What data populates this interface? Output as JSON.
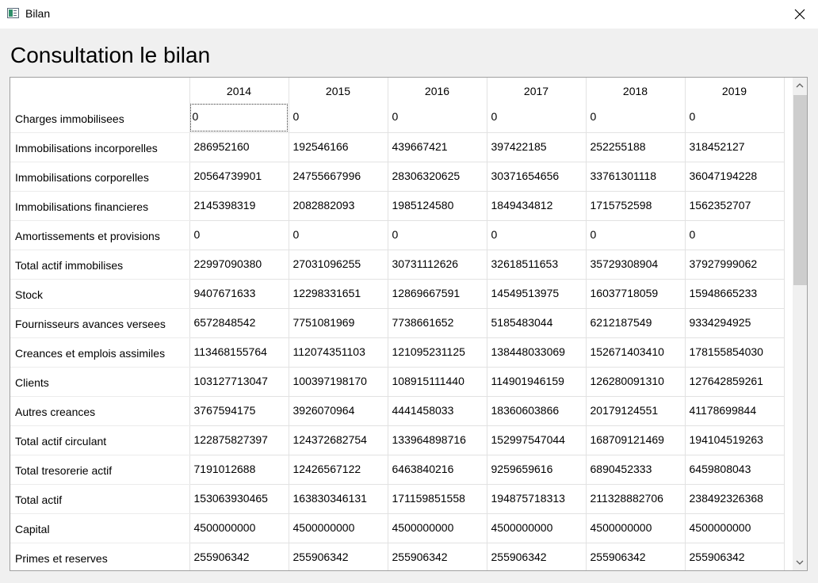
{
  "window": {
    "title": "Bilan",
    "icon": "app-window-icon",
    "close_icon": "close-icon"
  },
  "page": {
    "title": "Consultation le bilan"
  },
  "table": {
    "columns": [
      "2014",
      "2015",
      "2016",
      "2017",
      "2018",
      "2019"
    ],
    "rows": [
      {
        "label": "Charges immobilisees",
        "values": [
          "0",
          "0",
          "0",
          "0",
          "0",
          "0"
        ]
      },
      {
        "label": "Immobilisations incorporelles",
        "values": [
          "286952160",
          "192546166",
          "439667421",
          "397422185",
          "252255188",
          "318452127"
        ]
      },
      {
        "label": "Immobilisations corporelles",
        "values": [
          "20564739901",
          "24755667996",
          "28306320625",
          "30371654656",
          "33761301118",
          "36047194228"
        ]
      },
      {
        "label": "Immobilisations financieres",
        "values": [
          "2145398319",
          "2082882093",
          "1985124580",
          "1849434812",
          "1715752598",
          "1562352707"
        ]
      },
      {
        "label": "Amortissements et provisions",
        "values": [
          "0",
          "0",
          "0",
          "0",
          "0",
          "0"
        ]
      },
      {
        "label": "Total actif immobilises",
        "values": [
          "22997090380",
          "27031096255",
          "30731112626",
          "32618511653",
          "35729308904",
          "37927999062"
        ]
      },
      {
        "label": "Stock",
        "values": [
          "9407671633",
          "12298331651",
          "12869667591",
          "14549513975",
          "16037718059",
          "15948665233"
        ]
      },
      {
        "label": "Fournisseurs avances versees",
        "values": [
          "6572848542",
          "7751081969",
          "7738661652",
          "5185483044",
          "6212187549",
          "9334294925"
        ]
      },
      {
        "label": "Creances et emplois assimiles",
        "values": [
          "113468155764",
          "112074351103",
          "121095231125",
          "138448033069",
          "152671403410",
          "178155854030"
        ]
      },
      {
        "label": "Clients",
        "values": [
          "103127713047",
          "100397198170",
          "108915111440",
          "114901946159",
          "126280091310",
          "127642859261"
        ]
      },
      {
        "label": "Autres creances",
        "values": [
          "3767594175",
          "3926070964",
          "4441458033",
          "18360603866",
          "20179124551",
          "41178699844"
        ]
      },
      {
        "label": "Total actif circulant",
        "values": [
          "122875827397",
          "124372682754",
          "133964898716",
          "152997547044",
          "168709121469",
          "194104519263"
        ]
      },
      {
        "label": "Total tresorerie actif",
        "values": [
          "7191012688",
          "12426567122",
          "6463840216",
          "9259659616",
          "6890452333",
          "6459808043"
        ]
      },
      {
        "label": "Total actif",
        "values": [
          "153063930465",
          "163830346131",
          "171159851558",
          "194875718313",
          "211328882706",
          "238492326368"
        ]
      },
      {
        "label": "Capital",
        "values": [
          "4500000000",
          "4500000000",
          "4500000000",
          "4500000000",
          "4500000000",
          "4500000000"
        ]
      },
      {
        "label": "Primes et reserves",
        "values": [
          "255906342",
          "255906342",
          "255906342",
          "255906342",
          "255906342",
          "255906342"
        ]
      }
    ],
    "selected_cell": {
      "row": 0,
      "col": 0
    }
  },
  "scrollbar": {
    "up_icon": "chevron-up-icon",
    "down_icon": "chevron-down-icon",
    "position": 0.0
  }
}
